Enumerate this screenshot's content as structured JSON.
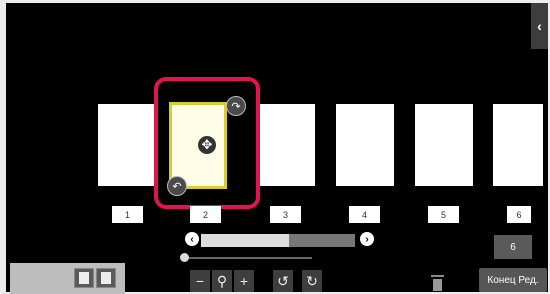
{
  "pages": [
    "1",
    "2",
    "3",
    "4",
    "5",
    "6"
  ],
  "current_page": "6",
  "scroll": {
    "left_icon": "‹",
    "right_icon": "›",
    "position_fraction": 0.57
  },
  "toolbar": {
    "zoom_out": "−",
    "zoom": "⚲",
    "zoom_in": "+",
    "rotate_left": "↺",
    "rotate_right": "↻"
  },
  "icons": {
    "collapse": "‹",
    "move": "✥",
    "rotate_top": "↷",
    "rotate_bottom": "↶"
  },
  "end_edit_label": "Конец Ред.",
  "colors": {
    "selection": "#e0144e",
    "selected_page_border": "#d9cc32"
  }
}
